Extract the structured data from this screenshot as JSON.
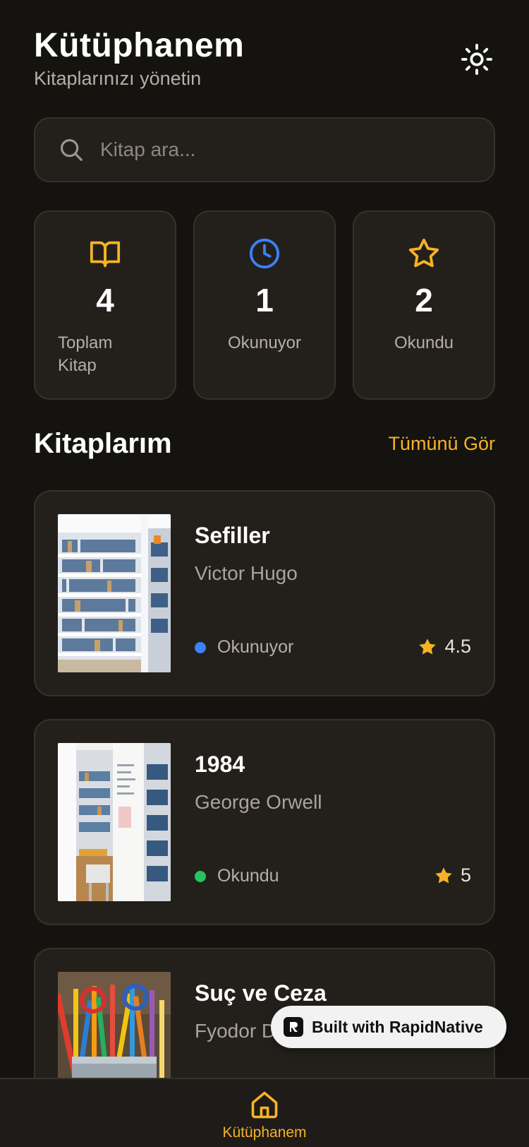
{
  "header": {
    "title": "Kütüphanem",
    "subtitle": "Kitaplarınızı yönetin"
  },
  "search": {
    "placeholder": "Kitap ara..."
  },
  "stats": [
    {
      "icon": "book-open-icon",
      "value": "4",
      "label": "Toplam Kitap",
      "color": "#f5b324"
    },
    {
      "icon": "clock-icon",
      "value": "1",
      "label": "Okunuyor",
      "color": "#3b82f6"
    },
    {
      "icon": "star-icon",
      "value": "2",
      "label": "Okundu",
      "color": "#f5b324"
    }
  ],
  "section": {
    "title": "Kitaplarım",
    "see_all": "Tümünü Gör"
  },
  "books": [
    {
      "title": "Sefiller",
      "author": "Victor Hugo",
      "status": "Okunuyor",
      "status_color": "#3b82f6",
      "rating": "4.5"
    },
    {
      "title": "1984",
      "author": "George Orwell",
      "status": "Okundu",
      "status_color": "#22c55e",
      "rating": "5"
    },
    {
      "title": "Suç ve Ceza",
      "author": "Fyodor Dostoyevski"
    }
  ],
  "badge": {
    "text": "Built with RapidNative"
  },
  "tabbar": {
    "home_label": "Kütüphanem"
  },
  "colors": {
    "accent": "#f5b324",
    "background": "#151310",
    "card": "#23201c"
  }
}
